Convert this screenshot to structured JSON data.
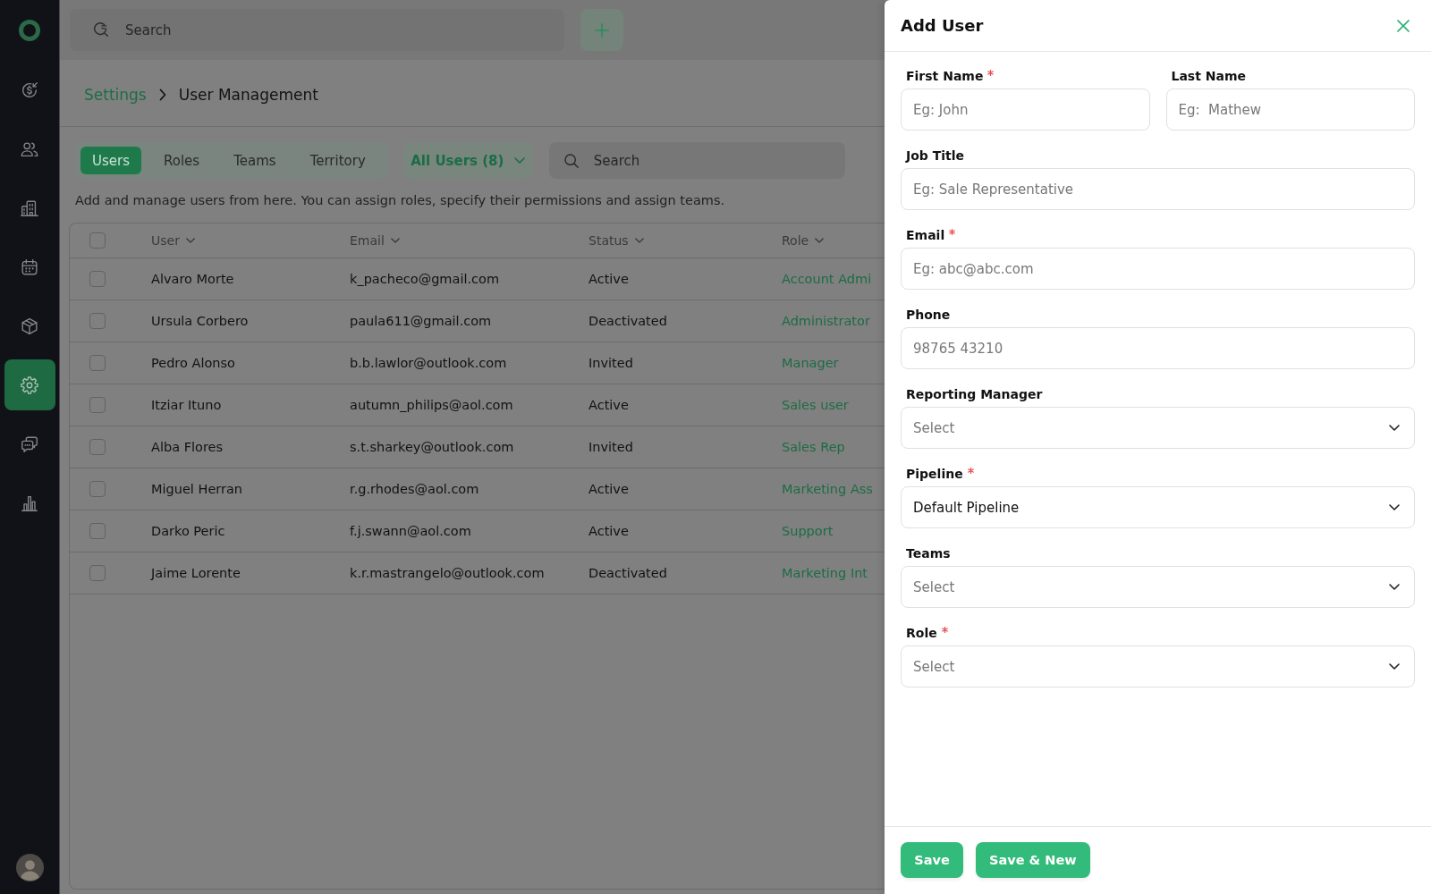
{
  "sidebar": {
    "items": [
      {
        "kind": "deals",
        "selected": false
      },
      {
        "kind": "contacts",
        "selected": false
      },
      {
        "kind": "companies",
        "selected": false
      },
      {
        "kind": "calendar",
        "selected": false
      },
      {
        "kind": "products",
        "selected": false
      },
      {
        "kind": "settings",
        "selected": true
      },
      {
        "kind": "messages",
        "selected": false
      },
      {
        "kind": "reports",
        "selected": false
      }
    ]
  },
  "topbar": {
    "search": {
      "placeholder": "Search"
    }
  },
  "breadcrumb": [
    {
      "kind": "link",
      "label": "Settings"
    },
    {
      "kind": "current",
      "label": "User Management"
    }
  ],
  "tabs": [
    {
      "label": "Users",
      "selected": true
    },
    {
      "label": "Roles",
      "selected": false
    },
    {
      "label": "Teams",
      "selected": false
    },
    {
      "label": "Territory",
      "selected": false
    }
  ],
  "filter": {
    "label": "All Users (8)"
  },
  "table_search": {
    "placeholder": "Search"
  },
  "description": "Add and manage users from here. You can assign roles, specify their permissions and assign teams.",
  "table": {
    "header_checkbox": {
      "checked": false
    },
    "columns": [
      "User",
      "Email",
      "Status",
      "Role"
    ],
    "rows": [
      {
        "checked": false,
        "user": "Alvaro Morte",
        "email": "k_pacheco@gmail.com",
        "status": "Active",
        "role": "Account Admi"
      },
      {
        "checked": false,
        "user": "Ursula Corbero",
        "email": "paula611@gmail.com",
        "status": "Deactivated",
        "role": "Administrator"
      },
      {
        "checked": false,
        "user": "Pedro Alonso",
        "email": "b.b.lawlor@outlook.com",
        "status": "Invited",
        "role": "Manager"
      },
      {
        "checked": false,
        "user": "Itziar Ituno",
        "email": "autumn_philips@aol.com",
        "status": "Active",
        "role": "Sales user"
      },
      {
        "checked": false,
        "user": "Alba Flores",
        "email": "s.t.sharkey@outlook.com",
        "status": "Invited",
        "role": "Sales Rep"
      },
      {
        "checked": false,
        "user": "Miguel Herran",
        "email": "r.g.rhodes@aol.com",
        "status": "Active",
        "role": "Marketing Ass"
      },
      {
        "checked": false,
        "user": "Darko Peric",
        "email": "f.j.swann@aol.com",
        "status": "Active",
        "role": "Support"
      },
      {
        "checked": false,
        "user": "Jaime Lorente",
        "email": "k.r.mastrangelo@outlook.com",
        "status": "Deactivated",
        "role": "Marketing Int"
      }
    ]
  },
  "drawer": {
    "title": "Add User",
    "rows": [
      {
        "fields": [
          {
            "label": "First Name",
            "required": true,
            "kind": "text",
            "placeholder": "Eg: John"
          },
          {
            "label": "Last Name",
            "required": false,
            "kind": "text",
            "placeholder": "Eg:  Mathew"
          }
        ]
      },
      {
        "fields": [
          {
            "label": "Job Title",
            "required": false,
            "kind": "text",
            "placeholder": "Eg: Sale Representative"
          }
        ]
      },
      {
        "fields": [
          {
            "label": "Email",
            "required": true,
            "kind": "text",
            "placeholder": "Eg: abc@abc.com"
          }
        ]
      },
      {
        "fields": [
          {
            "label": "Phone",
            "required": false,
            "kind": "text",
            "placeholder": "98765 43210"
          }
        ]
      },
      {
        "fields": [
          {
            "label": "Reporting Manager",
            "required": false,
            "kind": "select",
            "placeholder": "Select"
          }
        ]
      },
      {
        "fields": [
          {
            "label": "Pipeline",
            "required": true,
            "kind": "select",
            "value": "Default Pipeline"
          }
        ]
      },
      {
        "fields": [
          {
            "label": "Teams",
            "required": false,
            "kind": "select",
            "placeholder": "Select"
          }
        ]
      },
      {
        "fields": [
          {
            "label": "Role",
            "required": true,
            "kind": "select",
            "placeholder": "Select"
          }
        ]
      }
    ],
    "buttons": [
      "Save",
      "Save & New"
    ]
  }
}
